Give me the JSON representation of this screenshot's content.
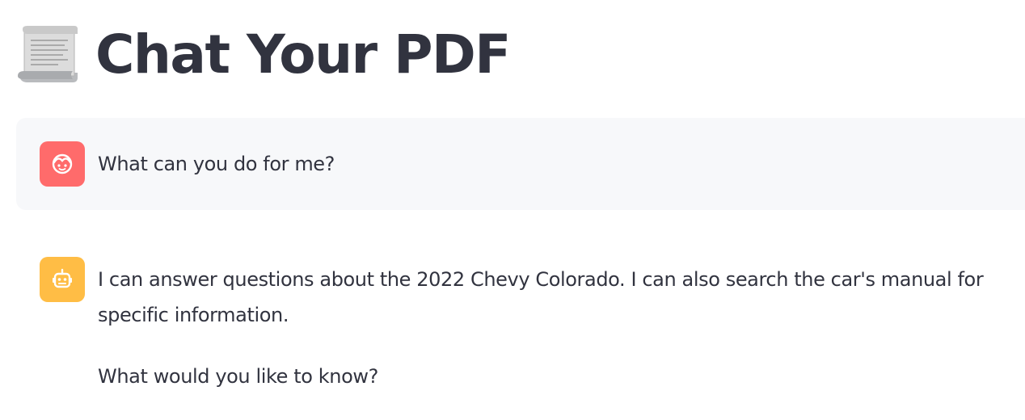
{
  "header": {
    "icon": "scroll-icon",
    "title": "Chat Your PDF"
  },
  "messages": [
    {
      "role": "user",
      "avatar_icon": "user-face-icon",
      "avatar_color": "#ff6b6b",
      "text": "What can you do for me?"
    },
    {
      "role": "assistant",
      "avatar_icon": "robot-icon",
      "avatar_color": "#ffbd45",
      "paragraphs": [
        "I can answer questions about the 2022 Chevy Colorado. I can also search the car's manual for specific information.",
        "What would you like to know?"
      ]
    }
  ]
}
